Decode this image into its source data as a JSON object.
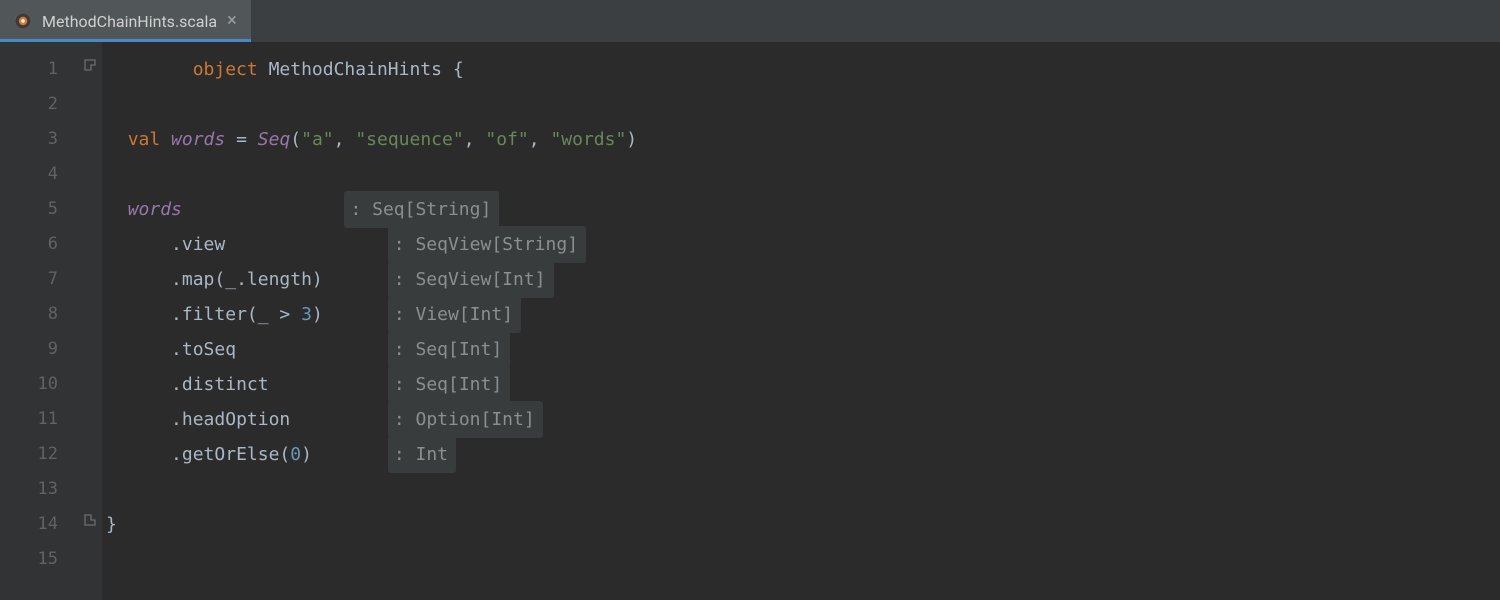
{
  "tab": {
    "filename": "MethodChainHints.scala",
    "close_glyph": "×"
  },
  "gutter": {
    "line_numbers": [
      "1",
      "2",
      "3",
      "4",
      "5",
      "6",
      "7",
      "8",
      "9",
      "10",
      "11",
      "12",
      "13",
      "14",
      "15"
    ]
  },
  "code": {
    "l1": {
      "kw_object": "object",
      "name": "MethodChainHints",
      "brace_open": "{"
    },
    "l3": {
      "kw_val": "val",
      "var": "words",
      "eq": "=",
      "seq": "Seq",
      "paren_open": "(",
      "s1": "\"a\"",
      "comma1": ", ",
      "s2": "\"sequence\"",
      "comma2": ", ",
      "s3": "\"of\"",
      "comma3": ", ",
      "s4": "\"words\"",
      "paren_close": ")"
    },
    "chain": {
      "head": {
        "ref": "words",
        "pad": "               ",
        "hint": ": Seq[String]"
      },
      "steps": [
        {
          "indent": "    ",
          "text": ".view",
          "pad": "               ",
          "hint": ": SeqView[String]"
        },
        {
          "indent": "    ",
          "text": ".map(_.length)",
          "pad": "      ",
          "hint": ": SeqView[Int]"
        },
        {
          "indent": "    ",
          "text_a": ".filter(_ > ",
          "num": "3",
          "text_b": ")",
          "pad": "      ",
          "hint": ": View[Int]"
        },
        {
          "indent": "    ",
          "text": ".toSeq",
          "pad": "              ",
          "hint": ": Seq[Int]"
        },
        {
          "indent": "    ",
          "text": ".distinct",
          "pad": "           ",
          "hint": ": Seq[Int]"
        },
        {
          "indent": "    ",
          "text": ".headOption",
          "pad": "         ",
          "hint": ": Option[Int]"
        },
        {
          "indent": "    ",
          "text_a": ".getOrElse(",
          "num": "0",
          "text_b": ")",
          "pad": "       ",
          "hint": ": Int"
        }
      ]
    },
    "l14": {
      "brace_close": "}"
    }
  }
}
